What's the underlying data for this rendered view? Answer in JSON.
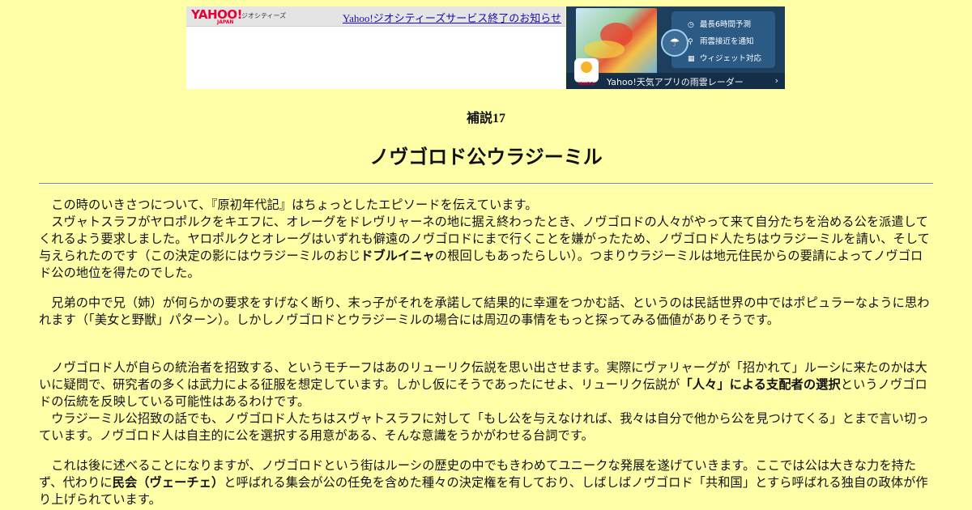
{
  "ad": {
    "yahoo_logo": "YAHOO!",
    "yahoo_japan": "JAPAN",
    "geocities_label": "ジオシティーズ",
    "notice_link": "Yahoo!ジオシティーズサービス終了のお知らせ",
    "features": [
      "最長6時間予測",
      "雨雲接近を通知",
      "ウィジェット対応"
    ],
    "app_icon_label": "YAHOO!",
    "app_banner_text": "Yahoo!天気アプリの雨雲レーダー",
    "app_banner_arrow": "›"
  },
  "article": {
    "small_title": "補説17",
    "title": "ノヴゴロド公ウラジーミル",
    "p1": "この時のいきさつについて、『原初年代記』はちょっとしたエピソードを伝えています。",
    "p2a": "スヴャトスラフがヤロポルクをキエフに、オレーグをドレヴリャーネの地に据え終わったとき、ノヴゴロドの人々がやって来て自分たちを治める公を派遣してくれるよう要求しました。ヤロポルクとオレーグはいずれも僻遠のノヴゴロドにまで行くことを嫌がったため、ノヴゴロド人たちはウラジーミルを請い、そして与えられたのです（この決定の影にはウラジーミルのおじ",
    "p2b": "ドブルイニャ",
    "p2c": "の根回しもあったらしい）。つまりウラジーミルは地元住民からの要請によってノヴゴロド公の地位を得たのでした。",
    "p3": "兄弟の中で兄（姉）が何らかの要求をすげなく断り、末っ子がそれを承諾して結果的に幸運をつかむ話、というのは民話世界の中ではポピュラーなように思われます（「美女と野獣」パターン）。しかしノヴゴロドとウラジーミルの場合には周辺の事情をもっと探ってみる価値がありそうです。",
    "p4a": "ノヴゴロド人が自らの統治者を招致する、というモチーフはあのリューリク伝説を思い出させます。実際にヴァリャーグが「招かれて」ルーシに来たのかは大いに疑問で、研究者の多くは武力による征服を想定しています。しかし仮にそうであったにせよ、リューリク伝説が",
    "p4b": "「人々」による支配者の選択",
    "p4c": "というノヴゴロドの伝統を反映している可能性はあるわけです。",
    "p5": "ウラジーミル公招致の話でも、ノヴゴロド人たちはスヴャトスラフに対して「もし公を与えなければ、我々は自分で他から公を見つけてくる」とまで言い切っています。ノヴゴロド人は自主的に公を選択する用意がある、そんな意識をうかがわせる台詞です。",
    "p6a": "これは後に述べることになりますが、ノヴゴロドという街はルーシの歴史の中でもきわめてユニークな発展を遂げていきます。ここでは公は大きな力を持たず、代わりに",
    "p6b": "民会（ヴェーチェ）",
    "p6c": "と呼ばれる集会が公の任免を含めた種々の決定権を有しており、しばしばノヴゴロド「共和国」とすら呼ばれる独自の政体が作り上げられています。"
  },
  "colors": {
    "page_background": "#ffffa8",
    "yahoo_red": "#e60033",
    "link_blue": "#1a0dab",
    "ad_navy": "#1d3e5c"
  },
  "icons": [
    "clock-icon",
    "pin-icon",
    "widget-icon",
    "rain-cloud-icon",
    "chevron-right-icon"
  ]
}
